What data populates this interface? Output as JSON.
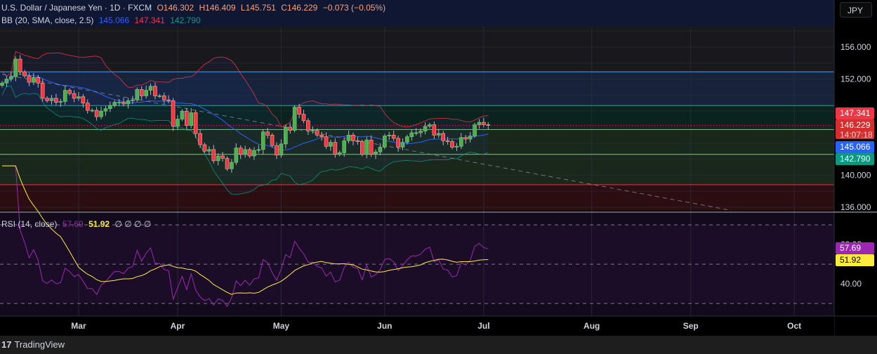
{
  "header": {
    "symbol": "U.S. Dollar / Japanese Yen · 1D · FXCM",
    "open": "O146.302",
    "high": "H146.409",
    "low": "L145.751",
    "close": "C146.229",
    "change": "−0.073 (−0.05%)",
    "bb_label": "BB (20, SMA, close, 2.5)",
    "bb_basis": "145.066",
    "bb_upper": "147.341",
    "bb_lower": "142.790",
    "rsi_label": "RSI (14, close)",
    "rsi_value": "57.69",
    "rsi_ma": "51.92",
    "rsi_extra": "∅ ∅ ∅ ∅"
  },
  "currency_button": "JPY",
  "price_axis": {
    "ticks": [
      "156.000",
      "152.000",
      "140.000",
      "136.000"
    ],
    "labels": {
      "upper": "147.341",
      "last": "146.229",
      "countdown": "14:07:18",
      "basis": "145.066",
      "lower": "142.790"
    }
  },
  "rsi_axis": {
    "ticks": [
      "60.00",
      "40.00"
    ],
    "labels": {
      "rsi": "57.69",
      "ma": "51.92"
    }
  },
  "footer": {
    "brand": "TradingView"
  },
  "colors": {
    "up": "#4caf50",
    "down": "#f23645",
    "bb_basis": "#2962ff",
    "bb_upper": "#f23645",
    "bb_lower": "#089981",
    "rsi": "#9c27b0",
    "rsi_ma": "#ffeb3b"
  },
  "chart_data": {
    "type": "candlestick",
    "title": "U.S. Dollar / Japanese Yen 1D",
    "ylim": [
      135.56,
      158.54
    ],
    "rsi_ylim": [
      23.6,
      76.1
    ],
    "price_ticks": [
      156,
      152,
      140,
      136
    ],
    "rsi_ticks": [
      60,
      40
    ],
    "rsi_levels": [
      70,
      50,
      30
    ],
    "current_price": 146.229,
    "horizontal_levels": [
      152.9,
      148.7,
      145.7,
      142.6,
      138.8
    ],
    "x_ticks": [
      {
        "label": "Mar",
        "bar": 17
      },
      {
        "label": "Apr",
        "bar": 39
      },
      {
        "label": "May",
        "bar": 62
      },
      {
        "label": "Jun",
        "bar": 85
      },
      {
        "label": "Jul",
        "bar": 107
      },
      {
        "label": "Aug",
        "bar": 131
      },
      {
        "label": "Sep",
        "bar": 153
      },
      {
        "label": "Oct",
        "bar": 176
      }
    ],
    "trendline": {
      "from": {
        "bar": 0,
        "price": 152.6
      },
      "to": {
        "bar": 162,
        "price": 135.6
      }
    },
    "first_open": 151.2,
    "closes": [
      151.5,
      152.0,
      152.3,
      154.5,
      152.9,
      152.4,
      151.6,
      152.2,
      151.5,
      149.6,
      149.3,
      149.6,
      149.1,
      149.2,
      150.6,
      150.2,
      149.6,
      149.8,
      149.0,
      148.1,
      148.1,
      147.3,
      148.0,
      148.3,
      148.7,
      149.1,
      149.1,
      148.9,
      149.3,
      149.4,
      150.7,
      149.9,
      150.6,
      151.1,
      149.9,
      149.9,
      149.4,
      149.3,
      146.1,
      147.0,
      148.0,
      146.2,
      147.8,
      145.2,
      143.8,
      143.0,
      143.2,
      141.8,
      142.4,
      142.1,
      140.8,
      141.6,
      143.4,
      142.6,
      143.2,
      142.4,
      143.1,
      143.2,
      145.4,
      145.0,
      143.7,
      142.5,
      143.9,
      146.0,
      145.6,
      148.5,
      147.6,
      146.8,
      145.6,
      145.6,
      145.0,
      144.8,
      143.6,
      144.1,
      142.6,
      142.8,
      144.3,
      145.0,
      144.3,
      144.2,
      142.6,
      144.4,
      142.6,
      142.9,
      143.5,
      144.9,
      145.0,
      144.6,
      143.5,
      144.1,
      144.8,
      145.3,
      145.3,
      145.5,
      146.1,
      146.3,
      145.0,
      145.2,
      144.3,
      144.2,
      143.5,
      143.6,
      144.7,
      144.5,
      144.9,
      146.3,
      146.6,
      146.3,
      146.229
    ]
  }
}
